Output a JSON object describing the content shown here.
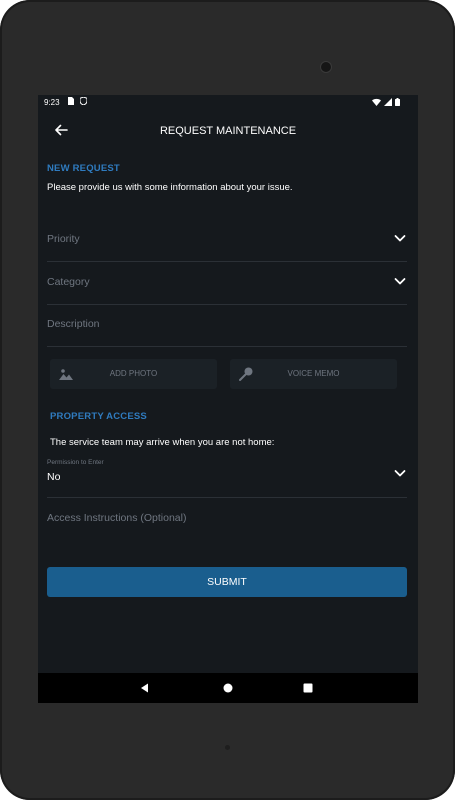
{
  "status_bar": {
    "time": "9:23"
  },
  "app_bar": {
    "title": "REQUEST MAINTENANCE"
  },
  "new_request": {
    "section_label": "NEW REQUEST",
    "intro": "Please provide us with some information about your issue."
  },
  "form": {
    "priority_placeholder": "Priority",
    "category_placeholder": "Category",
    "description_placeholder": "Description",
    "add_photo_label": "ADD PHOTO",
    "voice_memo_label": "VOICE MEMO"
  },
  "property_access": {
    "section_label": "PROPERTY ACCESS",
    "note": "The service team may arrive when you are not home:",
    "permission_label": "Permission to Enter",
    "permission_value": "No",
    "access_instructions_placeholder": "Access Instructions (Optional)"
  },
  "submit_label": "SUBMIT",
  "colors": {
    "accent": "#2f7bbf",
    "button": "#1a5e8e",
    "background": "#15191d"
  }
}
